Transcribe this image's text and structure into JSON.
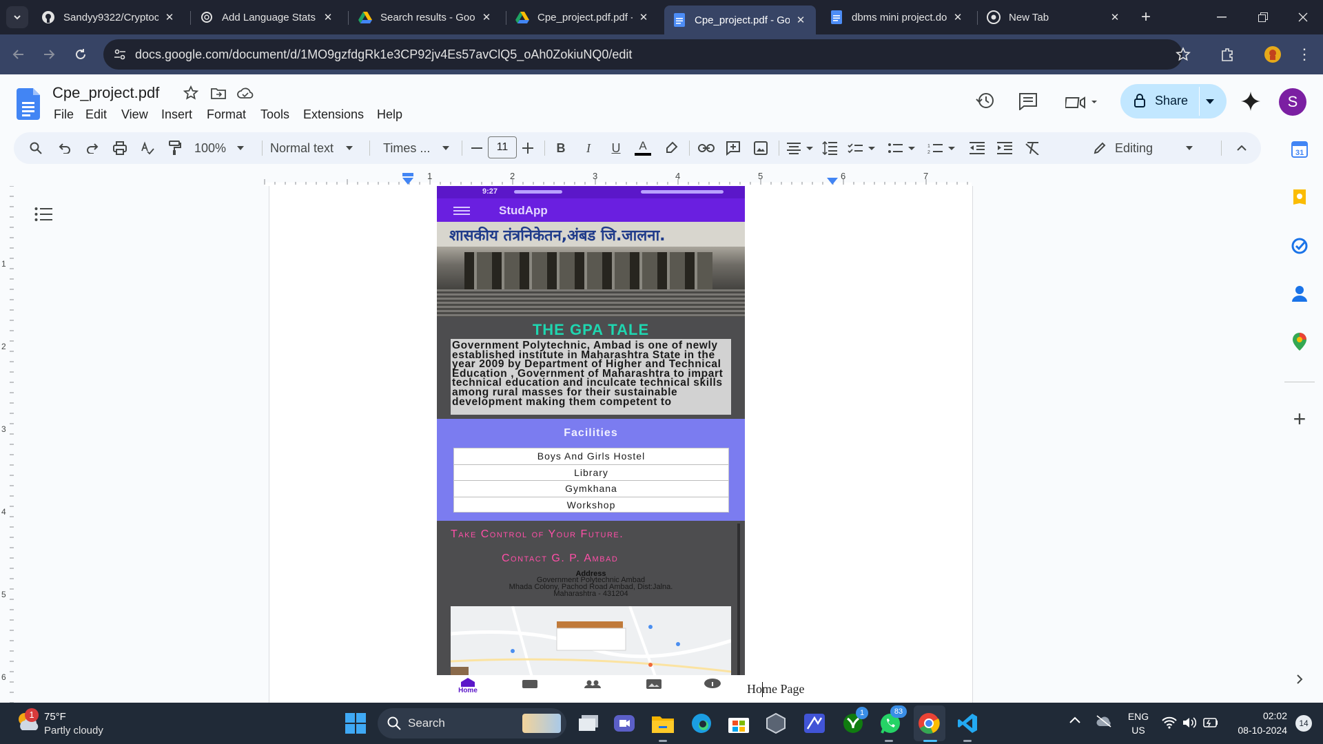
{
  "browser": {
    "tabs": [
      {
        "title": "Sandyy9322/Cryptoc",
        "favicon": "github-icon"
      },
      {
        "title": "Add Language Stats t",
        "favicon": "openai-icon"
      },
      {
        "title": "Search results - Goog",
        "favicon": "drive-icon"
      },
      {
        "title": "Cpe_project.pdf.pdf -",
        "favicon": "drive-icon"
      },
      {
        "title": "Cpe_project.pdf - Go",
        "favicon": "docs-icon",
        "active": true
      },
      {
        "title": "dbms mini project.do",
        "favicon": "docs-icon"
      },
      {
        "title": "New Tab",
        "favicon": "chrome-icon"
      }
    ],
    "url": "docs.google.com/document/d/1MO9gzfdgRk1e3CP92jv4Es57avClQ5_oAh0ZokiuNQ0/edit"
  },
  "docs": {
    "title": "Cpe_project.pdf",
    "menu": [
      "File",
      "Edit",
      "View",
      "Insert",
      "Format",
      "Tools",
      "Extensions",
      "Help"
    ],
    "share_label": "Share",
    "avatar_letter": "S",
    "toolbar": {
      "zoom": "100%",
      "style": "Normal text",
      "font": "Times ...",
      "font_size": "11",
      "mode": "Editing"
    },
    "ruler_h": [
      "1",
      "2",
      "3",
      "4",
      "5",
      "6",
      "7"
    ],
    "ruler_v": [
      "1",
      "2",
      "3",
      "4",
      "5",
      "6"
    ],
    "caption": "Home Page"
  },
  "phone": {
    "status_time": "9:27",
    "app_title": "StudApp",
    "banner_text": "शासकीय तंत्रनिकेतन,अंबड जि.जालना.",
    "heading": "THE GPA TALE",
    "intro": "Government Polytechnic, Ambad is one of newly established institute in Maharashtra State in the year 2009 by Department of Higher and Technical Education , Government of Maharashtra to impart technical education and inculcate technical skills among rural masses for their sustainable development making them competent to",
    "facilities_title": "Facilities",
    "facilities": [
      "Boys And Girls Hostel",
      "Library",
      "Gymkhana",
      "Workshop"
    ],
    "tagline1": "Take Control of Your Future.",
    "tagline2": "Contact G. P. Ambad",
    "address_label": "Address",
    "address_lines": [
      "Government Polytechnic Ambad",
      "Mhada Colony, Pachod Road Ambad, Dist:Jalna.",
      "Maharashtra - 431204"
    ],
    "nav_home": "Home"
  },
  "taskbar": {
    "temp": "75°F",
    "weather": "Partly cloudy",
    "weather_badge": "1",
    "search": "Search",
    "lang1": "ENG",
    "lang2": "US",
    "time": "02:02",
    "date": "08-10-2024",
    "xbox_badge": "1",
    "whatsapp_badge": "83",
    "notif_count": "14"
  },
  "colors": {
    "tabstrip": "#1f2330",
    "active_tab": "#374465",
    "share": "#c2e7ff",
    "phone_purple": "#6a1fe0",
    "facilities_bg": "#7b7cf0",
    "heading_teal": "#1fd6b0",
    "tagline_pink": "#ff4fa8"
  }
}
